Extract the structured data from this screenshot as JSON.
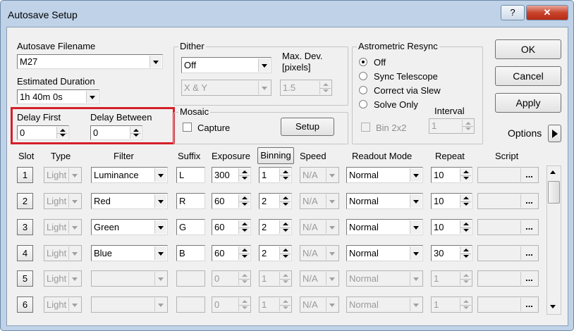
{
  "window": {
    "title": "Autosave Setup",
    "help_label": "?",
    "close_label": "✕"
  },
  "autosave_filename": {
    "label": "Autosave Filename",
    "value": "M27"
  },
  "estimated_duration": {
    "label": "Estimated Duration",
    "value": "1h 40m 0s"
  },
  "delay": {
    "first_label": "Delay First",
    "first_value": "0",
    "between_label": "Delay Between",
    "between_value": "0",
    "highlight_color": "#d4202a"
  },
  "dither": {
    "title": "Dither",
    "value": "Off",
    "axis_value": "X & Y",
    "max_dev_label_1": "Max. Dev.",
    "max_dev_label_2": "[pixels]",
    "max_dev_value": "1.5"
  },
  "mosaic": {
    "title": "Mosaic",
    "capture_label": "Capture",
    "setup_label": "Setup"
  },
  "resync": {
    "title": "Astrometric Resync",
    "options": [
      "Off",
      "Sync Telescope",
      "Correct via Slew",
      "Solve Only"
    ],
    "selected": "Off",
    "interval_label": "Interval",
    "interval_value": "1",
    "bin_label": "Bin 2x2"
  },
  "buttons": {
    "ok": "OK",
    "cancel": "Cancel",
    "apply": "Apply",
    "options": "Options"
  },
  "table": {
    "headers": {
      "slot": "Slot",
      "type": "Type",
      "filter": "Filter",
      "suffix": "Suffix",
      "exposure": "Exposure",
      "binning": "Binning",
      "speed": "Speed",
      "readout": "Readout Mode",
      "repeat": "Repeat",
      "script": "Script"
    },
    "rows": [
      {
        "slot": "1",
        "type": "Light",
        "filter": "Luminance",
        "suffix": "L",
        "exposure": "300",
        "binning": "1",
        "speed": "N/A",
        "readout": "Normal",
        "repeat": "10",
        "script": "...",
        "enabled": true
      },
      {
        "slot": "2",
        "type": "Light",
        "filter": "Red",
        "suffix": "R",
        "exposure": "60",
        "binning": "2",
        "speed": "N/A",
        "readout": "Normal",
        "repeat": "10",
        "script": "...",
        "enabled": true
      },
      {
        "slot": "3",
        "type": "Light",
        "filter": "Green",
        "suffix": "G",
        "exposure": "60",
        "binning": "2",
        "speed": "N/A",
        "readout": "Normal",
        "repeat": "10",
        "script": "...",
        "enabled": true
      },
      {
        "slot": "4",
        "type": "Light",
        "filter": "Blue",
        "suffix": "B",
        "exposure": "60",
        "binning": "2",
        "speed": "N/A",
        "readout": "Normal",
        "repeat": "30",
        "script": "...",
        "enabled": true
      },
      {
        "slot": "5",
        "type": "Light",
        "filter": "",
        "suffix": "",
        "exposure": "0",
        "binning": "1",
        "speed": "N/A",
        "readout": "Normal",
        "repeat": "1",
        "script": "...",
        "enabled": false
      },
      {
        "slot": "6",
        "type": "Light",
        "filter": "",
        "suffix": "",
        "exposure": "0",
        "binning": "1",
        "speed": "N/A",
        "readout": "Normal",
        "repeat": "1",
        "script": "...",
        "enabled": false
      }
    ]
  },
  "icons": {
    "scroll_up": "scroll-up-arrow-icon",
    "scroll_down": "scroll-down-arrow-icon",
    "options_arrow": "right-triangle-icon",
    "dropdown": "chevron-down-icon"
  }
}
